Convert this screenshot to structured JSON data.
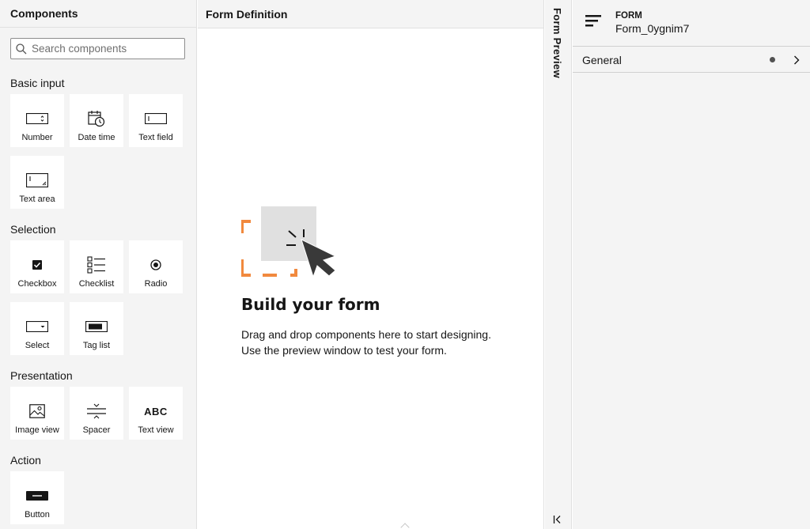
{
  "sidebar": {
    "title": "Components",
    "search": {
      "placeholder": "Search components",
      "value": ""
    },
    "sections": {
      "basic": {
        "title": "Basic input",
        "items": [
          {
            "label": "Number",
            "icon": "number-icon"
          },
          {
            "label": "Date time",
            "icon": "calendar-clock-icon"
          },
          {
            "label": "Text field",
            "icon": "text-field-icon"
          },
          {
            "label": "Text area",
            "icon": "text-area-icon"
          }
        ]
      },
      "selection": {
        "title": "Selection",
        "items": [
          {
            "label": "Checkbox",
            "icon": "checkbox-icon"
          },
          {
            "label": "Checklist",
            "icon": "checklist-icon"
          },
          {
            "label": "Radio",
            "icon": "radio-icon"
          },
          {
            "label": "Select",
            "icon": "select-icon"
          },
          {
            "label": "Tag list",
            "icon": "tag-list-icon"
          }
        ]
      },
      "presentation": {
        "title": "Presentation",
        "items": [
          {
            "label": "Image view",
            "icon": "image-icon"
          },
          {
            "label": "Spacer",
            "icon": "spacer-icon"
          },
          {
            "label": "Text view",
            "icon": "text-view-icon",
            "glyph": "ABC"
          }
        ]
      },
      "action": {
        "title": "Action",
        "items": [
          {
            "label": "Button",
            "icon": "button-icon"
          }
        ]
      }
    }
  },
  "canvas": {
    "title": "Form Definition",
    "empty_title": "Build your form",
    "empty_line1": "Drag and drop components here to start designing.",
    "empty_line2": "Use the preview window to test your form."
  },
  "preview": {
    "label": "Form Preview"
  },
  "properties": {
    "type": "FORM",
    "name": "Form_0ygnim7",
    "group": "General"
  },
  "colors": {
    "accent_orange": "#f1893e",
    "background": "#f4f4f4",
    "border": "#e0e0e0"
  }
}
